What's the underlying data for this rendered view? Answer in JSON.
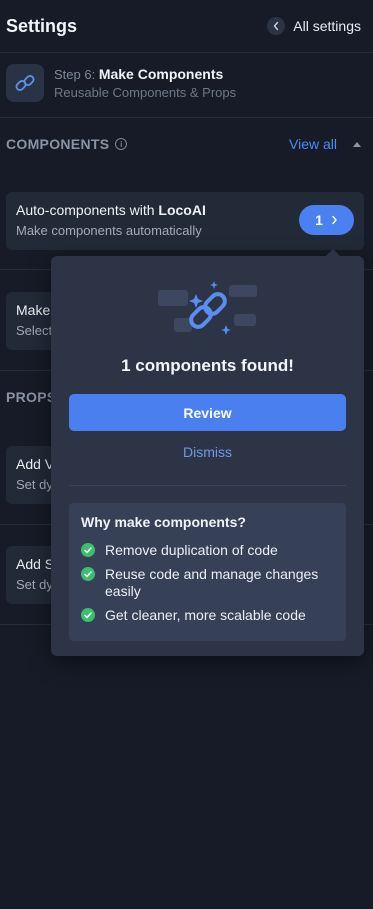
{
  "header": {
    "title": "Settings",
    "back_label": "All settings"
  },
  "step": {
    "prefix": "Step 6: ",
    "name": "Make Components",
    "subtitle": "Reusable Components & Props"
  },
  "components_section": {
    "label": "COMPONENTS",
    "info_icon": "i",
    "view_all": "View all"
  },
  "cards": [
    {
      "title_prefix": "Auto-components with ",
      "title_bold": "LocoAI",
      "subtitle": "Make components automatically",
      "count": "1"
    },
    {
      "title_prefix": "Make",
      "subtitle": "Select"
    },
    {
      "title_prefix": "Add V",
      "subtitle": "Set dy"
    },
    {
      "title_prefix": "Add S",
      "subtitle": "Set dy"
    }
  ],
  "props_section": {
    "label": "PROPS"
  },
  "popover": {
    "found_text": "1 components found!",
    "review_label": "Review",
    "dismiss_label": "Dismiss",
    "why_title": "Why make components?",
    "reasons": [
      "Remove duplication of code",
      "Reuse code and manage changes easily",
      "Get cleaner, more scalable code"
    ]
  },
  "colors": {
    "background": "#161b27",
    "accent": "#4a80f0",
    "check": "#3bbf6f"
  },
  "icons": {
    "back": "chevron-left-icon",
    "step": "link-icon",
    "pill": "chevron-right-icon",
    "illustration": "link-sparkle-icon"
  }
}
